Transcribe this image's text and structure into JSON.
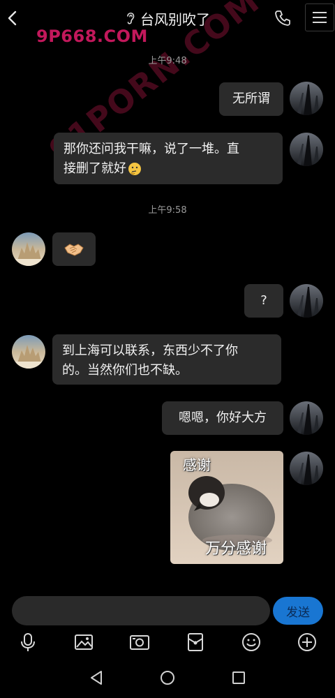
{
  "header": {
    "title": "台风别吹了",
    "icons": [
      "back-icon",
      "ear-icon",
      "phone-icon",
      "menu-icon"
    ]
  },
  "watermark": {
    "site": "9P668.COM",
    "diagonal": "91PORN.COM"
  },
  "messages": [
    {
      "type": "time",
      "text": "上午9:48"
    },
    {
      "type": "text",
      "side": "right",
      "text": "无所谓"
    },
    {
      "type": "text",
      "side": "right",
      "line1": "那你还问我干嘛，说了一堆。直",
      "line2": "接删了就好",
      "emoji": "thinking-face"
    },
    {
      "type": "time",
      "text": "上午9:58"
    },
    {
      "type": "emoji",
      "side": "left",
      "emoji": "handshake"
    },
    {
      "type": "text",
      "side": "right",
      "text": "?"
    },
    {
      "type": "text",
      "side": "left",
      "line1": "到上海可以联系，东西少不了你",
      "line2": "的。当然你们也不缺。"
    },
    {
      "type": "text",
      "side": "right",
      "text": "嗯嗯，你好大方"
    },
    {
      "type": "sticker",
      "side": "right",
      "top_text": "感谢",
      "bottom_text": "万分感谢"
    }
  ],
  "input": {
    "placeholder": "",
    "send_label": "发送"
  },
  "toolbar": [
    "microphone-icon",
    "image-icon",
    "camera-icon",
    "red-packet-icon",
    "smiley-icon",
    "plus-icon"
  ],
  "navbar": [
    "nav-back-icon",
    "nav-home-icon",
    "nav-recent-icon"
  ],
  "colors": {
    "background": "#000000",
    "bubble": "#2b2b2b",
    "send_button": "#1976d2",
    "watermark": "#c2185b"
  }
}
